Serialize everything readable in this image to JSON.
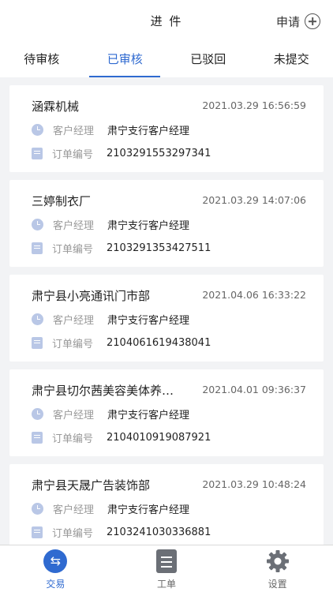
{
  "header": {
    "title": "进 件",
    "apply_label": "申请",
    "apply_icon": "plus-circle-icon"
  },
  "tabs": [
    {
      "label": "待审核",
      "active": false
    },
    {
      "label": "已审核",
      "active": true
    },
    {
      "label": "已驳回",
      "active": false
    },
    {
      "label": "未提交",
      "active": false
    }
  ],
  "labels": {
    "manager": "客户经理",
    "order_no": "订单编号"
  },
  "cards": [
    {
      "name": "涵霖机械",
      "time": "2021.03.29 16:56:59",
      "manager": "肃宁支行客户经理",
      "order_no": "2103291553297341"
    },
    {
      "name": "三婷制衣厂",
      "time": "2021.03.29 14:07:06",
      "manager": "肃宁支行客户经理",
      "order_no": "2103291353427511"
    },
    {
      "name": "肃宁县小亮通讯门市部",
      "time": "2021.04.06 16:33:22",
      "manager": "肃宁支行客户经理",
      "order_no": "2104061619438041"
    },
    {
      "name": "肃宁县切尔茜美容美体养…",
      "time": "2021.04.01 09:36:37",
      "manager": "肃宁支行客户经理",
      "order_no": "2104010919087921"
    },
    {
      "name": "肃宁县天晟广告装饰部",
      "time": "2021.03.29 10:48:24",
      "manager": "肃宁支行客户经理",
      "order_no": "2103241030336881"
    }
  ],
  "bottom_nav": [
    {
      "label": "交易",
      "icon": "exchange-icon",
      "active": true
    },
    {
      "label": "工单",
      "icon": "worksheet-icon",
      "active": false
    },
    {
      "label": "设置",
      "icon": "gear-icon",
      "active": false
    }
  ],
  "colors": {
    "accent": "#2f6ad0",
    "background": "#f2f3f5",
    "icon_tint": "#b9c7e6"
  }
}
